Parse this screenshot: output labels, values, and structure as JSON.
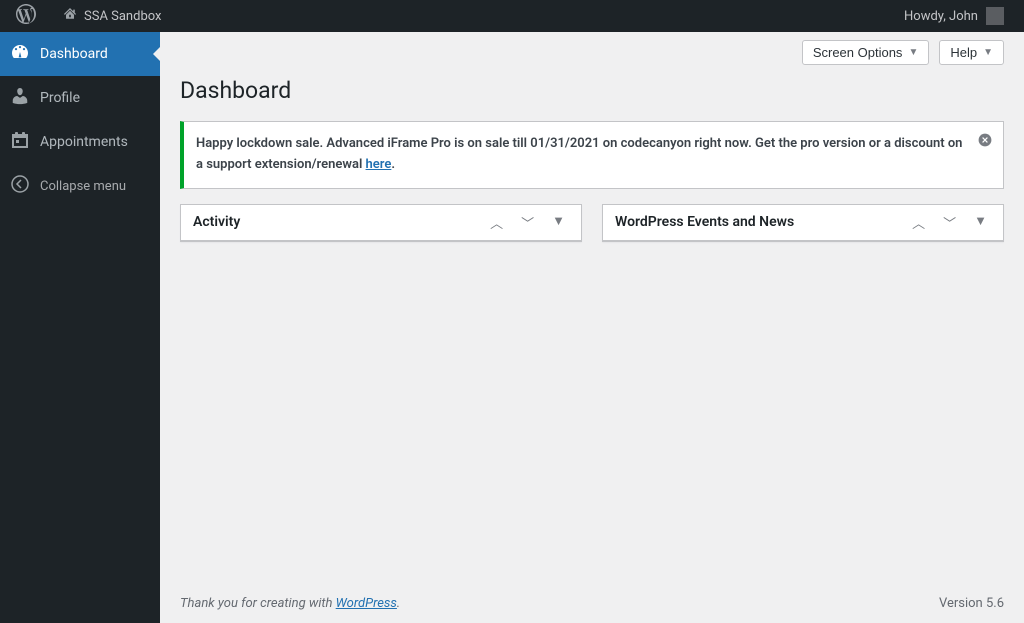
{
  "admin_bar": {
    "site_name": "SSA Sandbox",
    "greeting": "Howdy, John"
  },
  "sidebar": {
    "items": [
      {
        "label": "Dashboard",
        "icon": "dashboard-icon",
        "active": true
      },
      {
        "label": "Profile",
        "icon": "person-icon",
        "active": false
      },
      {
        "label": "Appointments",
        "icon": "calendar-icon",
        "active": false
      }
    ],
    "collapse_label": "Collapse menu"
  },
  "top_controls": {
    "screen_options": "Screen Options",
    "help": "Help"
  },
  "page": {
    "title": "Dashboard"
  },
  "notice": {
    "text_before_link": "Happy lockdown sale. Advanced iFrame Pro is on sale till 01/31/2021 on codecanyon right now. Get the pro version or a discount on a support extension/renewal ",
    "link_text": "here",
    "text_after_link": "."
  },
  "widgets": [
    {
      "title": "Activity"
    },
    {
      "title": "WordPress Events and News"
    }
  ],
  "footer": {
    "thank_you_prefix": "Thank you for creating with ",
    "thank_you_link": "WordPress",
    "thank_you_suffix": ".",
    "version": "Version 5.6"
  }
}
